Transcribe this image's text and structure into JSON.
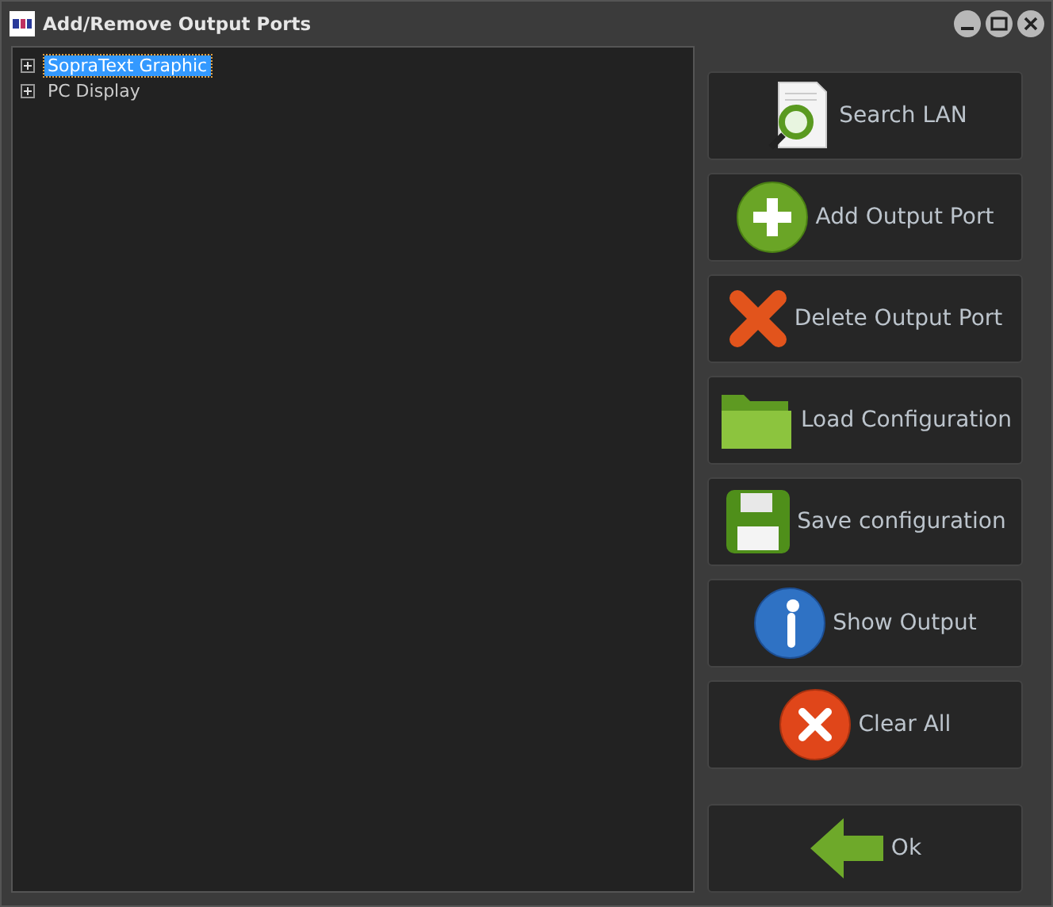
{
  "window": {
    "title": "Add/Remove Output Ports"
  },
  "tree": {
    "items": [
      {
        "label": "SopraText Graphic",
        "selected": true,
        "expanded": false
      },
      {
        "label": "PC Display",
        "selected": false,
        "expanded": false
      }
    ]
  },
  "buttons": [
    {
      "label": "Search LAN",
      "kind": "search"
    },
    {
      "label": "Add Output Port",
      "kind": "add"
    },
    {
      "label": "Delete Output Port",
      "kind": "delete"
    },
    {
      "label": "Load Configuration",
      "kind": "folder"
    },
    {
      "label": "Save configuration",
      "kind": "save"
    },
    {
      "label": "Show Output",
      "kind": "info"
    },
    {
      "label": "Clear All",
      "kind": "clear"
    },
    {
      "label": "Ok",
      "kind": "back"
    }
  ]
}
